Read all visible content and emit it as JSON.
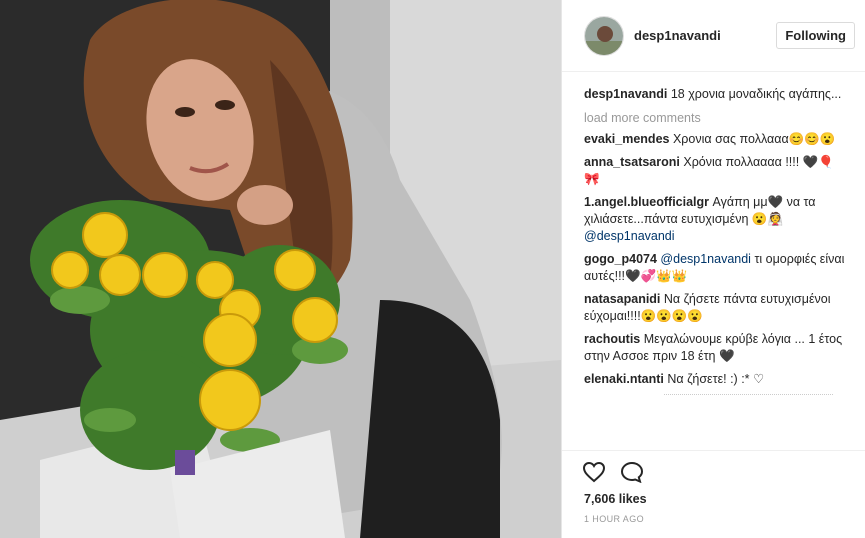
{
  "post": {
    "username": "desp1navandi",
    "follow_label": "Following",
    "caption": "18 χρονια μοναδικής αγάπης...",
    "load_more": "load more comments",
    "likes": "7,606 likes",
    "time": "1 HOUR AGO"
  },
  "comments": [
    {
      "user": "evaki_mendes",
      "text": "Χρονια σας πολλααα😊😊😮"
    },
    {
      "user": "anna_tsatsaroni",
      "text": "Χρόνια πολλαααα !!!! 🖤🎈🎀"
    },
    {
      "user": "1.angel.blueofficialgr",
      "text": "Αγάπη μμ🖤 να τα χιλιάσετε...πάντα ευτυχισμένη 😮👰",
      "mention": "@desp1navandi"
    },
    {
      "user": "gogo_p4074",
      "mention": "@desp1navandi",
      "text": "τι ομορφιές είναι αυτές!!!🖤💞👑👑"
    },
    {
      "user": "natasapanidi",
      "text": "Να ζήσετε πάντα ευτυχισμένοι εύχομαι!!!!😮😮😮😮"
    },
    {
      "user": "rachoutis",
      "text": "Μεγαλώνουμε κρύβε λόγια ... 1 έτος στην Ασσοε πριν 18 έτη 🖤"
    },
    {
      "user": "elenaki.ntanti",
      "text": "Να ζήσετε! :) :* ♡"
    }
  ],
  "icons": {
    "like": "heart-outline-icon",
    "comment": "speech-bubble-icon"
  }
}
